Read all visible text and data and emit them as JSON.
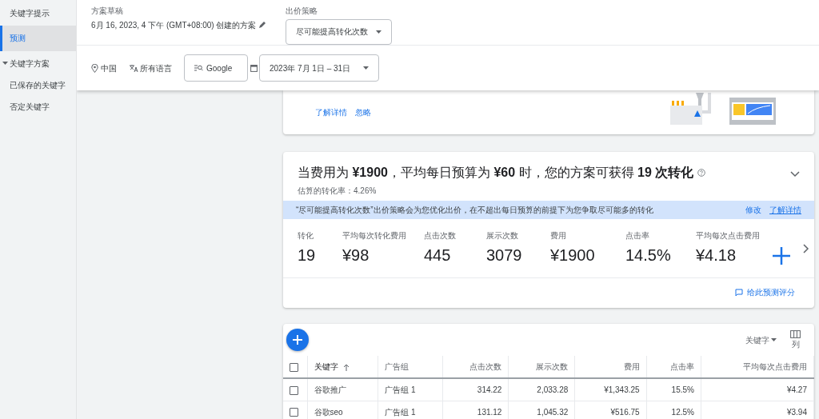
{
  "sidebar": {
    "items": [
      {
        "label": "关键字提示",
        "selected": false
      },
      {
        "label": "预测",
        "selected": true
      },
      {
        "label": "关键字方案",
        "selected": false,
        "expanded": true,
        "children": [
          {
            "label": "已保存的关键字",
            "selected": false
          },
          {
            "label": "否定关键字",
            "selected": false
          }
        ]
      }
    ]
  },
  "header": {
    "plan_label": "方案草稿",
    "plan_value": "6月 16, 2023, 4 下午 (GMT+08:00) 创建的方案",
    "bid_label": "出价策略",
    "bid_value": "尽可能提高转化次数",
    "location": "中国",
    "language": "所有语言",
    "network": "Google",
    "date_range": "2023年 7月 1日 – 31日"
  },
  "tip_card": {
    "links": [
      "了解详情",
      "忽略"
    ]
  },
  "forecast": {
    "headline": "当费用为 **¥1900**，平均每日预算为 **¥60** 时，您的方案可获得 **19** **次转化**",
    "expanded": true,
    "rate": "估算的转化率：4.26%",
    "banner": "“尽可能提高转化次数”出价策略会为您优化出价，在不超出每日预算的前提下为您争取尽可能多的转化",
    "banner_links": [
      "修改",
      "了解详情"
    ],
    "metrics": [
      {
        "label": "转化",
        "value": "19"
      },
      {
        "label": "平均每次转化费用",
        "value": "¥98"
      },
      {
        "label": "点击次数",
        "value": "445"
      },
      {
        "label": "展示次数",
        "value": "3079"
      },
      {
        "label": "费用",
        "value": "¥1900"
      },
      {
        "label": "点击率",
        "value": "14.5%"
      },
      {
        "label": "平均每次点击费用",
        "value": "¥4.18"
      }
    ],
    "feedback": "给此预测评分"
  },
  "table": {
    "view": "关键字",
    "columns_button": "列",
    "select_all": {
      "checked": false
    },
    "columns": [
      {
        "label": "关键字",
        "sorted": true
      },
      {
        "label": "广告组",
        "sorted": false
      },
      {
        "label": "点击次数",
        "sorted": false
      },
      {
        "label": "展示次数",
        "sorted": false
      },
      {
        "label": "费用",
        "sorted": false
      },
      {
        "label": "点击率",
        "sorted": false
      },
      {
        "label": "平均每次点击费用",
        "sorted": false
      }
    ],
    "rows": [
      {
        "checked": false,
        "cells": [
          "谷歌推广",
          "广告组 1",
          "314.22",
          "2,033.28",
          "¥1,343.25",
          "15.5%",
          "¥4.27"
        ]
      },
      {
        "checked": false,
        "cells": [
          "谷歌seo",
          "广告组 1",
          "131.12",
          "1,045.32",
          "¥516.75",
          "12.5%",
          "¥3.94"
        ]
      }
    ]
  }
}
